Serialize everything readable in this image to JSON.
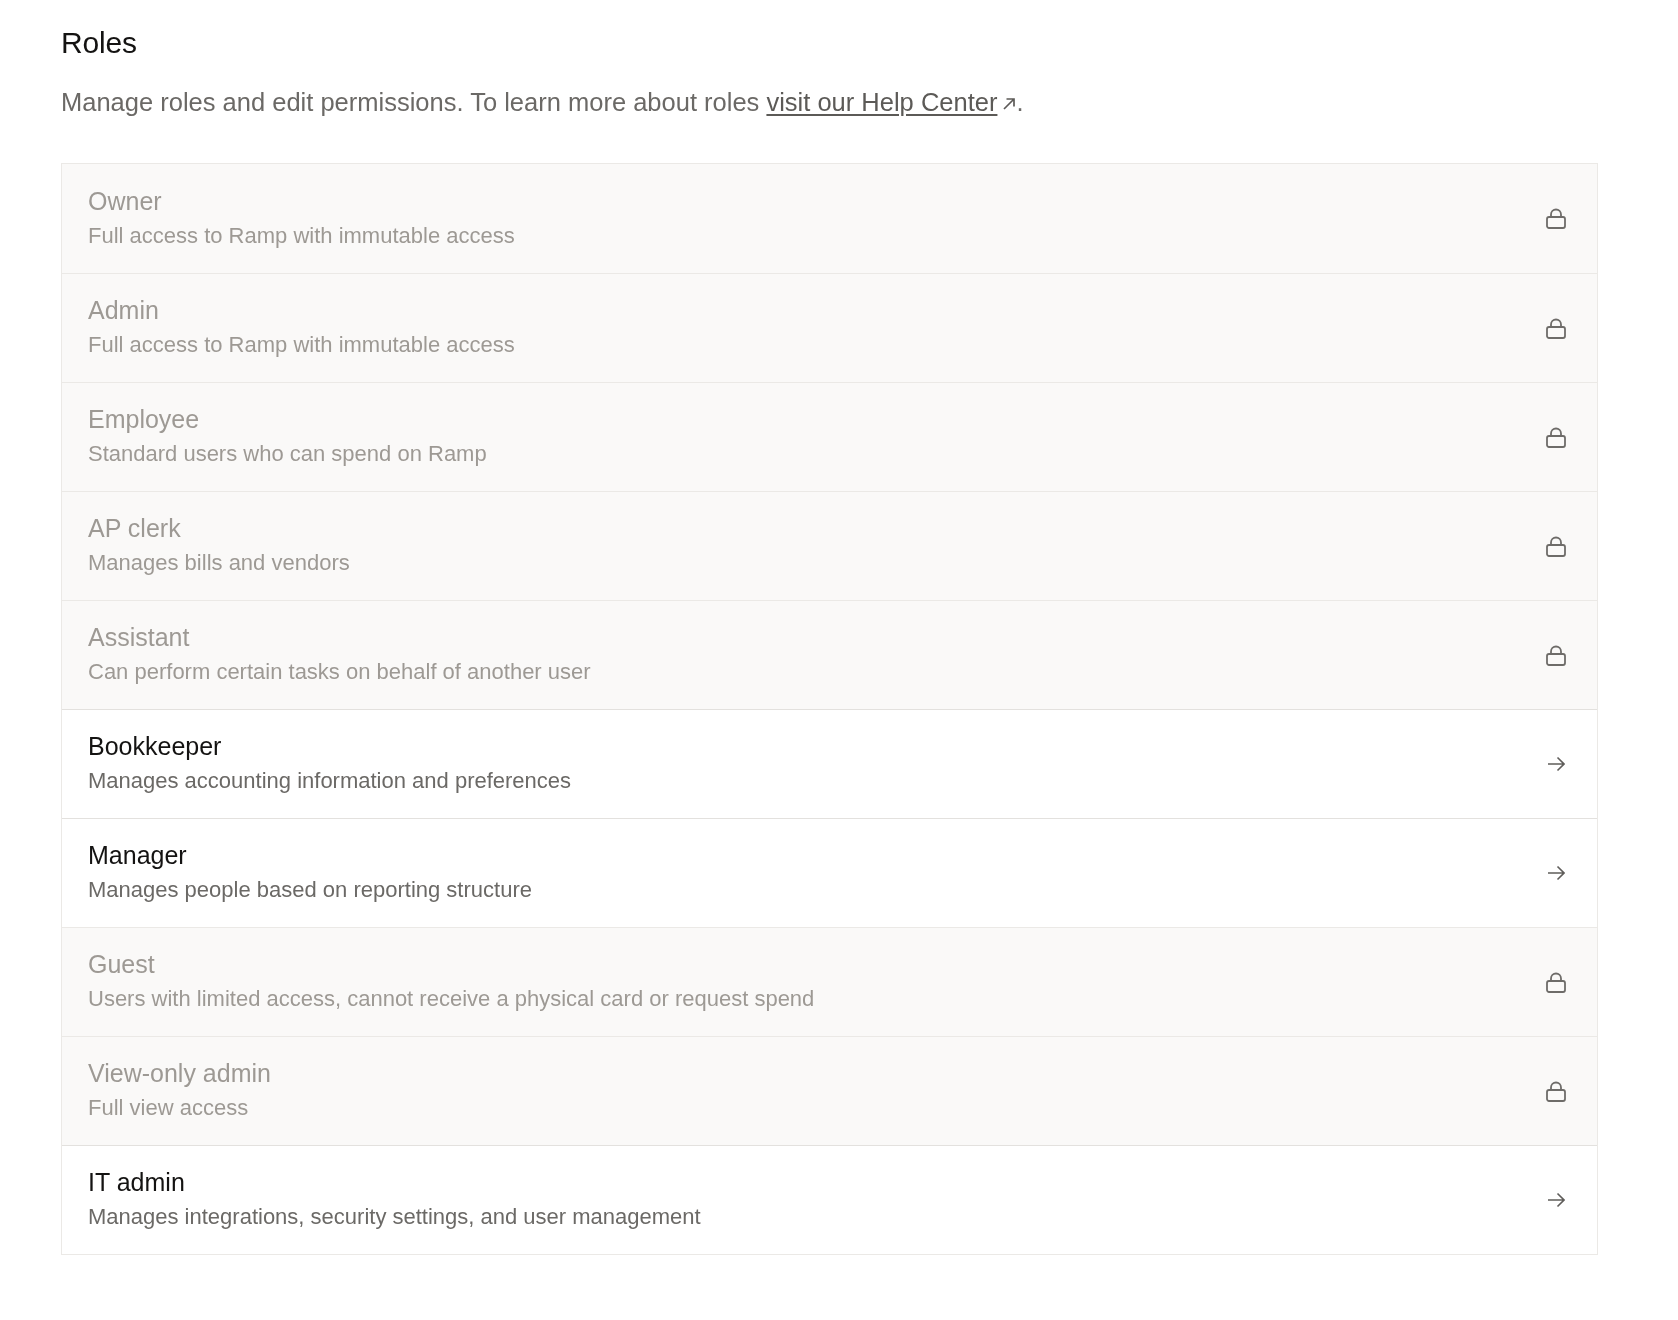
{
  "title": "Roles",
  "description": {
    "text": "Manage roles and edit permissions. To learn more about roles",
    "link": "visit our Help Center",
    "suffix": "."
  },
  "roles": [
    {
      "name": "Owner",
      "description": "Full access to Ramp with immutable access",
      "locked": true
    },
    {
      "name": "Admin",
      "description": "Full access to Ramp with immutable access",
      "locked": true
    },
    {
      "name": "Employee",
      "description": "Standard users who can spend on Ramp",
      "locked": true
    },
    {
      "name": "AP clerk",
      "description": "Manages bills and vendors",
      "locked": true
    },
    {
      "name": "Assistant",
      "description": "Can perform certain tasks on behalf of another user",
      "locked": true
    },
    {
      "name": "Bookkeeper",
      "description": "Manages accounting information and preferences",
      "locked": false
    },
    {
      "name": "Manager",
      "description": "Manages people based on reporting structure",
      "locked": false
    },
    {
      "name": "Guest",
      "description": "Users with limited access, cannot receive a physical card or request spend",
      "locked": true
    },
    {
      "name": "View-only admin",
      "description": "Full view access",
      "locked": true
    },
    {
      "name": "IT admin",
      "description": "Manages integrations, security settings, and user management",
      "locked": false
    }
  ]
}
